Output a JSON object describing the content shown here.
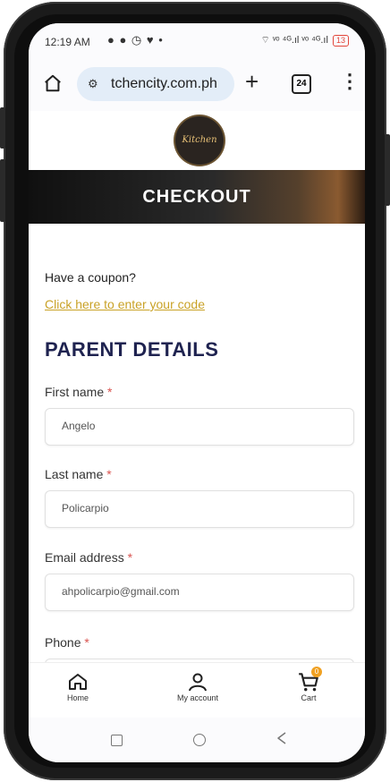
{
  "status": {
    "time": "12:19 AM",
    "left_icons": "● ● ◷ ♥ •",
    "right_icons": "⌔ ᵛᵒ ⁴ᴳ.ıl ᵛᵒ ⁴ᴳ.ıl",
    "battery": "13"
  },
  "browser": {
    "url": "tchencity.com.ph",
    "tab_count": "24"
  },
  "site": {
    "logo_text": "Kitchen City",
    "banner_title": "CHECKOUT"
  },
  "coupon": {
    "question": "Have a coupon?",
    "link": "Click here to enter your code"
  },
  "section": {
    "title": "PARENT DETAILS"
  },
  "form": {
    "required_mark": "*",
    "fields": [
      {
        "label": "First name",
        "value": "Angelo"
      },
      {
        "label": "Last name",
        "value": "Policarpio"
      },
      {
        "label": "Email address",
        "value": "ahpolicarpio@gmail.com"
      },
      {
        "label": "Phone",
        "value": ""
      }
    ]
  },
  "bottom_nav": {
    "items": [
      {
        "label": "Home",
        "icon": "home-icon"
      },
      {
        "label": "My account",
        "icon": "user-icon"
      },
      {
        "label": "Cart",
        "icon": "cart-icon",
        "badge": "0"
      }
    ]
  },
  "colors": {
    "link": "#c9a227",
    "section_title": "#1f2350",
    "required": "#d9534f",
    "cart_badge": "#f0a020"
  }
}
